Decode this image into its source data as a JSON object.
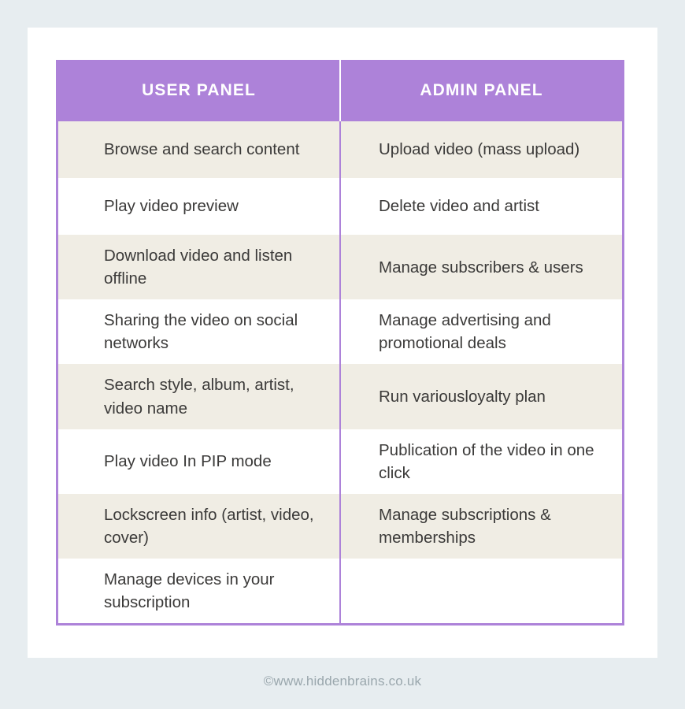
{
  "theme": {
    "page_background": "#e7edf0",
    "card_background": "#ffffff",
    "accent_purple": "#ad82d9",
    "row_shade": "#f0ede4",
    "row_plain": "#ffffff",
    "text_color": "#3b3a39",
    "header_text_color": "#ffffff",
    "footer_text_color": "#9aa7ad"
  },
  "table": {
    "headers": [
      {
        "label": "USER PANEL"
      },
      {
        "label": "ADMIN PANEL"
      }
    ],
    "rows": [
      {
        "user": "Browse and search content",
        "admin": "Upload video (mass upload)"
      },
      {
        "user": "Play video preview",
        "admin": "Delete video and artist"
      },
      {
        "user": "Download video and listen offline",
        "admin": "Manage subscribers & users"
      },
      {
        "user": "Sharing the video on social networks",
        "admin": "Manage advertising and promotional deals"
      },
      {
        "user": "Search style, album, artist, video name",
        "admin": "Run variousloyalty plan"
      },
      {
        "user": "Play video In PIP mode",
        "admin": "Publication of the video in one click"
      },
      {
        "user": "Lockscreen info (artist, video, cover)",
        "admin": "Manage subscriptions & memberships"
      },
      {
        "user": "Manage devices in your subscription",
        "admin": ""
      }
    ]
  },
  "footer": {
    "credit": "©www.hiddenbrains.co.uk"
  }
}
